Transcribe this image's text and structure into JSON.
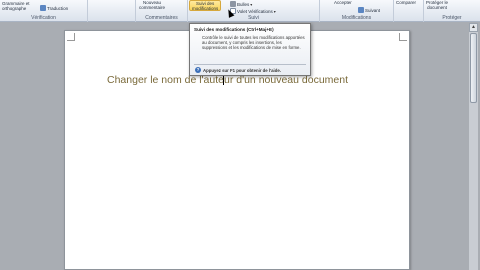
{
  "ribbon": {
    "verification": {
      "label": "Vérification",
      "grammar": "Grammaire et",
      "spelling": "orthographe",
      "translation": "Traduction"
    },
    "comments": {
      "label": "Commentaires",
      "new_line1": "Nouveau",
      "new_line2": "commentaire"
    },
    "tracking": {
      "label": "Suivi",
      "track_line1": "Suivi des",
      "track_line2": "modifications",
      "bubbles": "Bulles",
      "display": "Volet Vérifications"
    },
    "changes": {
      "label": "Modifications",
      "accept": "Accepter",
      "next": "Suivant"
    },
    "compare": {
      "label": "Comparer"
    },
    "protect": {
      "label": "Protéger",
      "protect_line1": "Protéger le",
      "protect_line2": "document"
    }
  },
  "tooltip": {
    "title": "Suivi des modifications (Ctrl+Maj+E)",
    "body": "Contrôle le suivi de toutes les modifications apportées au document, y compris les insertions, les suppressions et les modifications de mise en forme.",
    "help": "Appuyez sur F1 pour obtenir de l'aide."
  },
  "document": {
    "title_text": "Changer le nom de l'auteur d'un nouveau document"
  },
  "colors": {
    "ribbon_bg": "#e7ecf3",
    "highlight": "#f9d45a",
    "workspace": "#a9adb3",
    "title_color": "#7a6a3a"
  },
  "icons": [
    "spelling-icon",
    "translate-icon",
    "comment-icon",
    "track-changes-icon",
    "bubbles-icon",
    "accept-icon",
    "next-icon",
    "compare-icon",
    "protect-icon",
    "help-icon"
  ]
}
